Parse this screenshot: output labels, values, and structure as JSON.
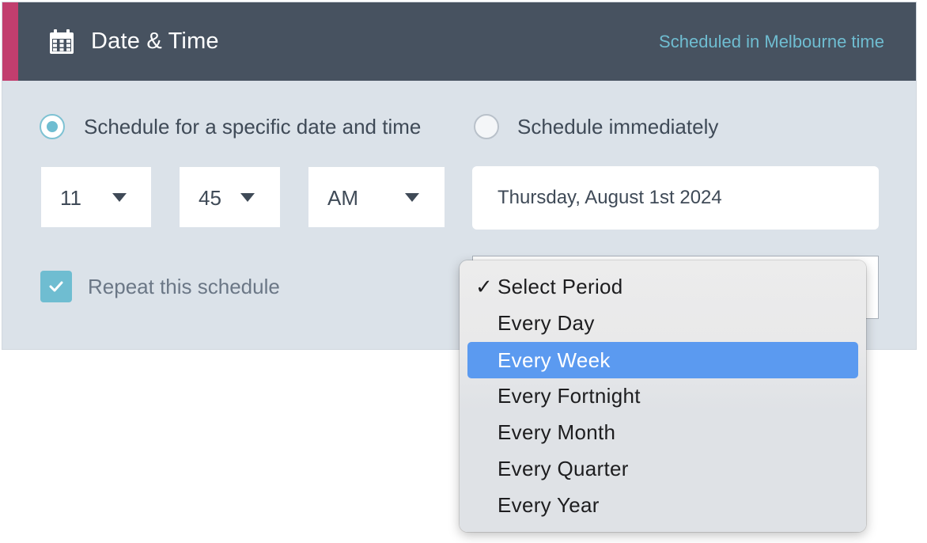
{
  "header": {
    "title": "Date & Time",
    "subtitle": "Scheduled in Melbourne time",
    "icon": "calendar-icon",
    "accent_color": "#c23e6e",
    "bg_color": "#475260"
  },
  "schedule_options": {
    "specific": {
      "label": "Schedule for a specific date and time",
      "selected": true
    },
    "immediate": {
      "label": "Schedule immediately",
      "selected": false
    }
  },
  "time": {
    "hour": "11",
    "minute": "45",
    "ampm": "AM"
  },
  "date": {
    "value": "Thursday, August 1st 2024"
  },
  "repeat": {
    "label": "Repeat this schedule",
    "checked": true
  },
  "period_dropdown": {
    "selected_check": "✓",
    "options": [
      "Select Period",
      "Every Day",
      "Every Week",
      "Every Fortnight",
      "Every Month",
      "Every Quarter",
      "Every Year"
    ],
    "selected": "Select Period",
    "highlighted": "Every Week",
    "highlight_color": "#5b9af0"
  }
}
